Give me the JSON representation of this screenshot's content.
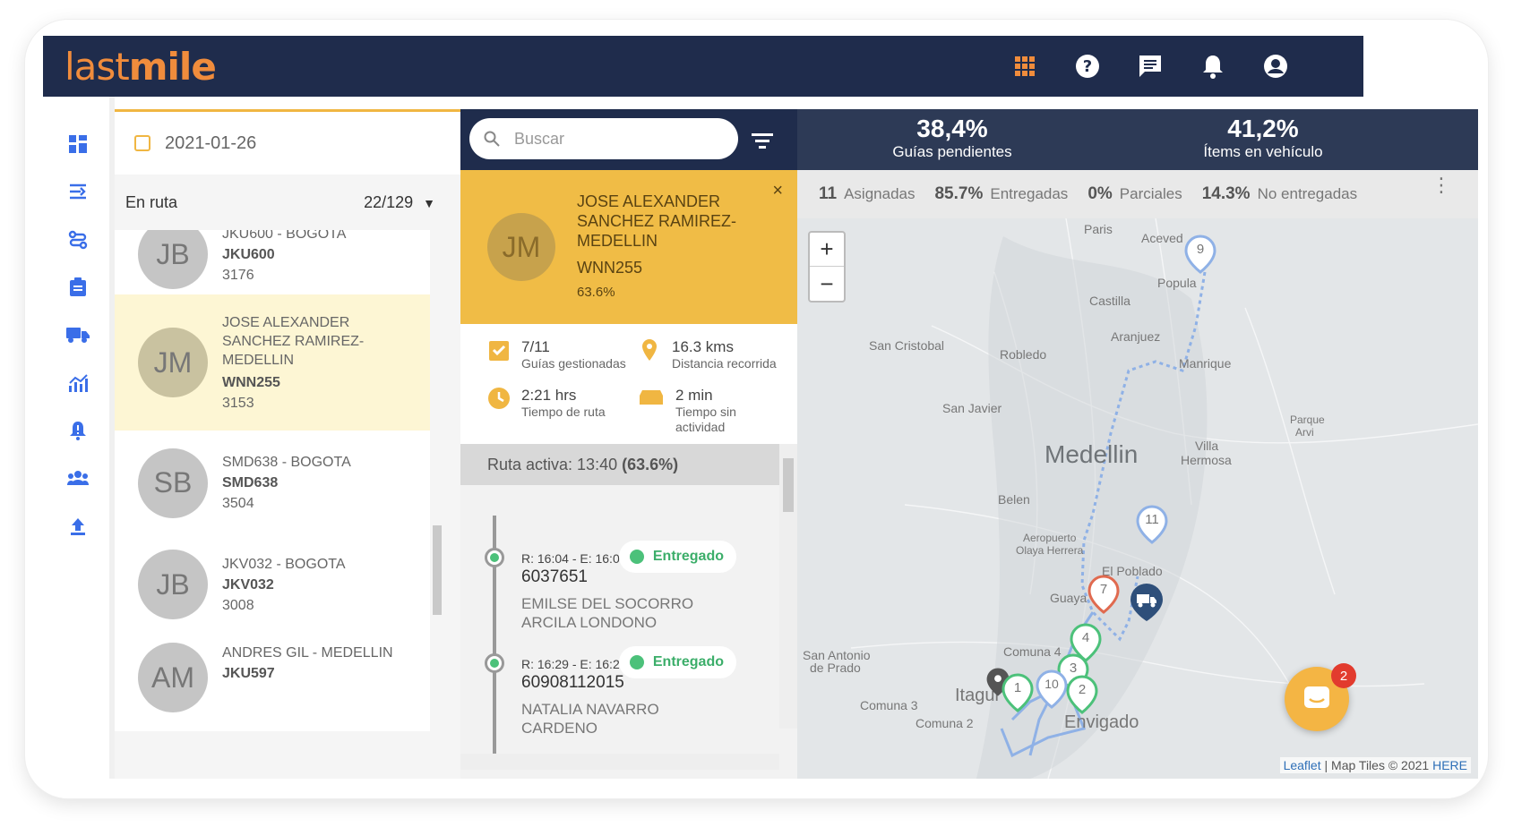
{
  "app": {
    "logo_light": "last",
    "logo_bold": "mile"
  },
  "header_icons": [
    "apps-grid-icon",
    "help-icon",
    "chat-icon",
    "bell-icon",
    "account-icon"
  ],
  "nav_icons": [
    "dashboard-icon",
    "routes-icon",
    "planning-icon",
    "orders-icon",
    "truck-icon",
    "analytics-icon",
    "alerts-icon",
    "team-icon",
    "upload-icon"
  ],
  "list": {
    "date": "2021-01-26",
    "status": "En ruta",
    "count": "22/129",
    "items": [
      {
        "initials": "JB",
        "title": "JKU600 - BOGOTA",
        "plate": "JKU600",
        "num": "3176"
      },
      {
        "initials": "JM",
        "title_lines": [
          "JOSE ALEXANDER",
          "SANCHEZ RAMIREZ-",
          "MEDELLIN"
        ],
        "plate": "WNN255",
        "num": "3153"
      },
      {
        "initials": "SB",
        "title": "SMD638 - BOGOTA",
        "plate": "SMD638",
        "num": "3504"
      },
      {
        "initials": "JB",
        "title": "JKV032 - BOGOTA",
        "plate": "JKV032",
        "num": "3008"
      },
      {
        "initials": "AM",
        "title": "ANDRES GIL - MEDELLIN",
        "plate": "JKU597"
      }
    ]
  },
  "search": {
    "placeholder": "Buscar"
  },
  "detail": {
    "initials": "JM",
    "name_lines": [
      "JOSE ALEXANDER",
      "SANCHEZ RAMIREZ-",
      "MEDELLIN"
    ],
    "plate": "WNN255",
    "pct": "63.6%",
    "close": "×",
    "stats": {
      "guias_value": "7/11",
      "guias_label": "Guías gestionadas",
      "dist_value": "16.3 kms",
      "dist_label": "Distancia recorrida",
      "tiempo_value": "2:21 hrs",
      "tiempo_label": "Tiempo de ruta",
      "inact_value": "2 min",
      "inact_label1": "Tiempo sin",
      "inact_label2": "actividad"
    },
    "ruta_prefix": "Ruta activa: 13:40 ",
    "ruta_pct": "(63.6%)",
    "timeline": [
      {
        "times": "R: 16:04 - E: 16:01",
        "id": "6037651",
        "client1": "EMILSE DEL SOCORRO",
        "client2": "ARCILA LONDONO",
        "status": "Entregado"
      },
      {
        "times": "R: 16:29 - E: 16:28",
        "id": "60908112015",
        "client1": "NATALIA NAVARRO",
        "client2": "CARDENO",
        "status": "Entregado"
      }
    ]
  },
  "kpis": [
    {
      "value": "38,4%",
      "label": "Guías pendientes"
    },
    {
      "value": "41,2%",
      "label": "Ítems en vehículo"
    }
  ],
  "counts": [
    {
      "n": "11",
      "label": "Asignadas"
    },
    {
      "n": "85.7%",
      "label": "Entregadas"
    },
    {
      "n": "0%",
      "label": "Parciales"
    },
    {
      "n": "14.3%",
      "label": "No entregadas"
    }
  ],
  "map": {
    "labels": {
      "paris": "Paris",
      "aceved": "Aceved",
      "popula": "Popula",
      "castilla": "Castilla",
      "aranjuez": "Aranjuez",
      "sancristobal": "San Cristobal",
      "robledo": "Robledo",
      "manrique": "Manrique",
      "sanjavier": "San Javier",
      "medellin": "Medellin",
      "villa1": "Villa",
      "villa2": "Hermosa",
      "parque1": "Parque",
      "parque2": "Arvi",
      "belen": "Belen",
      "aero1": "Aeropuerto",
      "aero2": "Olaya Herrera",
      "poblado": "El Poblado",
      "guaya": "Guaya",
      "comuna4": "Comuna 4",
      "santonio1": "San Antonio",
      "santonio2": "de Prado",
      "comuna3": "Comuna 3",
      "itagui": "Itagui",
      "comuna2": "Comuna 2",
      "envigado": "Envigado"
    },
    "markers": [
      "9",
      "11",
      "7",
      "4",
      "3",
      "10",
      "1",
      "2"
    ],
    "zoom_in": "+",
    "zoom_out": "−",
    "attrib_link": "Leaflet",
    "attrib_text": " | Map Tiles © 2021 ",
    "attrib_here": "HERE"
  },
  "chat_badge": "2"
}
